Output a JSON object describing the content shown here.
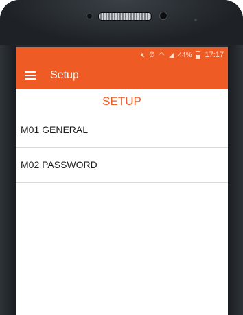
{
  "status_bar": {
    "icons": [
      "mute-icon",
      "alarm-icon",
      "wifi-icon",
      "signal-icon",
      "battery-icon"
    ],
    "battery_percent": "44%",
    "time": "17:17"
  },
  "app_bar": {
    "menu_icon": "hamburger-menu-icon",
    "title": "Setup"
  },
  "page": {
    "heading": "SETUP",
    "items": [
      {
        "label": "M01 GENERAL"
      },
      {
        "label": "M02 PASSWORD"
      }
    ]
  },
  "colors": {
    "accent": "#ef5b24",
    "text": "#1a1a1a",
    "divider": "#d9d9d9"
  }
}
